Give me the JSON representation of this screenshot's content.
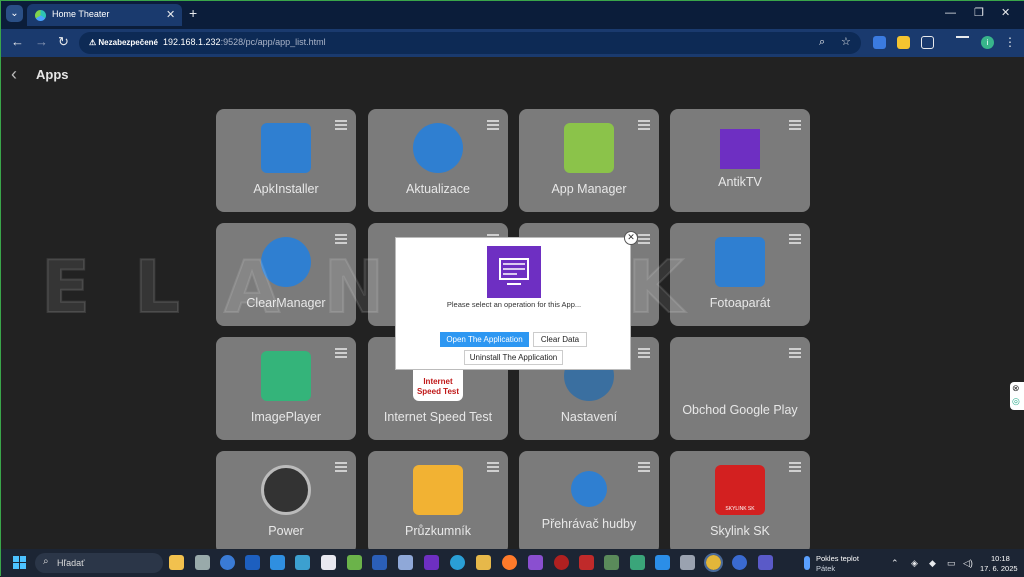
{
  "browser": {
    "tab_title": "Home Theater",
    "new_tab_symbol": "+",
    "close_symbol": "✕",
    "security_label": "Nezabezpečené",
    "url_host": "192.168.1.232",
    "url_path": ":9528/pc/app/app_list.html",
    "profile_initial": "i"
  },
  "page": {
    "title": "Apps",
    "watermark": "ELANDSK",
    "apps": [
      {
        "label": "ApkInstaller",
        "icon": "android-installer-icon",
        "color": "#2f7fd1"
      },
      {
        "label": "Aktualizace",
        "icon": "upload-arrow-icon",
        "color": "#2f7fd1"
      },
      {
        "label": "App Manager",
        "icon": "android-robot-icon",
        "color": "#8bc34a"
      },
      {
        "label": "AntikTV",
        "icon": "tv-icon",
        "color": "#6e2fc2"
      },
      {
        "label": "ClearManager",
        "icon": "rocket-icon",
        "color": "#2f7fd1"
      },
      {
        "label": "",
        "icon": "",
        "color": "#7b7b7b"
      },
      {
        "label": "",
        "icon": "",
        "color": "#7b7b7b"
      },
      {
        "label": "Fotoaparát",
        "icon": "camera-icon",
        "color": "#2f7fd1"
      },
      {
        "label": "ImagePlayer",
        "icon": "image-icon",
        "color": "#34b47a"
      },
      {
        "label": "Internet Speed Test",
        "icon": "speed-test-icon",
        "color": "#ffffff"
      },
      {
        "label": "Nastavení",
        "icon": "wrench-icon",
        "color": "#3a6fa0"
      },
      {
        "label": "Obchod Google Play",
        "icon": "play-store-icon",
        "color": "#4caf50"
      },
      {
        "label": "Power",
        "icon": "power-icon",
        "color": "#333333"
      },
      {
        "label": "Průzkumník",
        "icon": "folder-icon",
        "color": "#f2b233"
      },
      {
        "label": "Přehrávač hudby",
        "icon": "music-icon",
        "color": "#2f7fd1"
      },
      {
        "label": "Skylink SK",
        "icon": "skylink-icon",
        "color": "#d32020"
      }
    ],
    "speed_test_text_1": "Internet",
    "speed_test_text_2": "Speed Test",
    "skylink_text": "SKYLINK SK"
  },
  "dialog": {
    "message": "Please select an operation for this App...",
    "open_label": "Open The Application",
    "clear_label": "Clear Data",
    "uninstall_label": "Uninstall The Application",
    "close_symbol": "✕"
  },
  "taskbar": {
    "search_placeholder": "Hľadať",
    "weather_title": "Pokles teplot",
    "weather_sub": "Pátek",
    "time": "10:18",
    "date": "17. 6. 2025"
  },
  "colors": {
    "accent": "#2d97f2",
    "tile_bg": "#7b7b7b",
    "chrome_bg": "#1a3a6e"
  }
}
